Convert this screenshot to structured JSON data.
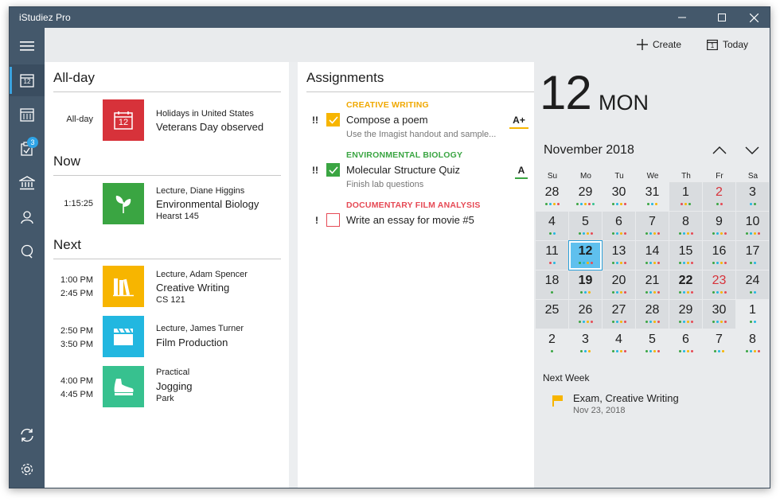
{
  "app": {
    "title": "iStudiez Pro"
  },
  "toolbar": {
    "create_label": "Create",
    "today_label": "Today",
    "today_icon_number": "1"
  },
  "sidebar": {
    "calendar_number": "12",
    "assignments_badge": "3"
  },
  "schedule": {
    "allday_title": "All-day",
    "now_title": "Now",
    "next_title": "Next",
    "allday": {
      "time": "All-day",
      "icon_number": "12",
      "subtitle": "Holidays in United States",
      "title": "Veterans Day observed",
      "color": "#d7323a"
    },
    "now": {
      "time": "1:15:25",
      "subtitle": "Lecture, Diane Higgins",
      "title": "Environmental Biology",
      "location": "Hearst 145",
      "color": "#3aa542"
    },
    "next": [
      {
        "start": "1:00 PM",
        "end": "2:45 PM",
        "subtitle": "Lecture, Adam Spencer",
        "title": "Creative Writing",
        "location": "CS 121",
        "color": "#f7b500",
        "icon": "books-icon"
      },
      {
        "start": "2:50 PM",
        "end": "3:50 PM",
        "subtitle": "Lecture, James Turner",
        "title": "Film Production",
        "location": "",
        "color": "#22b7e0",
        "icon": "clapperboard-icon"
      },
      {
        "start": "4:00 PM",
        "end": "4:45 PM",
        "subtitle": "Practical",
        "title": "Jogging",
        "location": "Park",
        "color": "#37c18f",
        "icon": "sneaker-icon"
      }
    ]
  },
  "assignments": {
    "title": "Assignments",
    "items": [
      {
        "category": "CREATIVE WRITING",
        "category_color": "#f0a800",
        "priority": "!!",
        "title": "Compose a poem",
        "note": "Use the Imagist handout and sample...",
        "grade": "A+",
        "checked": true,
        "check_color": "#f7b500"
      },
      {
        "category": "ENVIRONMENTAL BIOLOGY",
        "category_color": "#3aa542",
        "priority": "!!",
        "title": "Molecular Structure Quiz",
        "note": "Finish lab questions",
        "grade": "A",
        "checked": true,
        "check_color": "#3aa542"
      },
      {
        "category": "DOCUMENTARY FILM ANALYSIS",
        "category_color": "#e64a55",
        "priority": "!",
        "title": "Write an essay for movie #5",
        "note": "",
        "grade": "",
        "checked": false,
        "check_color": "#e64a55"
      }
    ]
  },
  "calendar": {
    "big_date": "12",
    "big_day": "MON",
    "month_label": "November 2018",
    "weekdays": [
      "Su",
      "Mo",
      "Tu",
      "We",
      "Th",
      "Fr",
      "Sa"
    ],
    "weeks": [
      [
        {
          "d": "28",
          "c": [
            "#3aa542",
            "#22b7e0",
            "#f7b500",
            "#e64a55"
          ]
        },
        {
          "d": "29",
          "c": [
            "#3aa542",
            "#22b7e0",
            "#f7b500",
            "#e64a55",
            "#37c18f"
          ]
        },
        {
          "d": "30",
          "c": [
            "#3aa542",
            "#22b7e0",
            "#f7b500",
            "#e64a55"
          ]
        },
        {
          "d": "31",
          "c": [
            "#3aa542",
            "#22b7e0",
            "#f7b500"
          ]
        },
        {
          "d": "1",
          "c": [
            "#e64a55",
            "#f7b500",
            "#3aa542"
          ],
          "cur": true
        },
        {
          "d": "2",
          "c": [
            "#3aa542",
            "#e64a55"
          ],
          "cur": true,
          "red": true
        },
        {
          "d": "3",
          "c": [
            "#22b7e0",
            "#3aa542"
          ],
          "cur": true
        }
      ],
      [
        {
          "d": "4",
          "c": [
            "#3aa542",
            "#22b7e0"
          ],
          "cur": true
        },
        {
          "d": "5",
          "c": [
            "#3aa542",
            "#22b7e0",
            "#f7b500",
            "#e64a55"
          ],
          "cur": true
        },
        {
          "d": "6",
          "c": [
            "#3aa542",
            "#22b7e0",
            "#f7b500",
            "#e64a55"
          ],
          "cur": true
        },
        {
          "d": "7",
          "c": [
            "#3aa542",
            "#22b7e0",
            "#f7b500",
            "#e64a55"
          ],
          "cur": true
        },
        {
          "d": "8",
          "c": [
            "#3aa542",
            "#22b7e0",
            "#f7b500",
            "#e64a55"
          ],
          "cur": true
        },
        {
          "d": "9",
          "c": [
            "#3aa542",
            "#22b7e0",
            "#f7b500",
            "#e64a55"
          ],
          "cur": true
        },
        {
          "d": "10",
          "c": [
            "#3aa542",
            "#22b7e0",
            "#f7b500",
            "#e64a55"
          ],
          "cur": true
        }
      ],
      [
        {
          "d": "11",
          "c": [
            "#e64a55",
            "#22b7e0"
          ],
          "cur": true
        },
        {
          "d": "12",
          "c": [
            "#3aa542",
            "#22b7e0",
            "#f7b500",
            "#e64a55"
          ],
          "cur": true,
          "sel": true,
          "bold": true
        },
        {
          "d": "13",
          "c": [
            "#3aa542",
            "#22b7e0",
            "#f7b500",
            "#e64a55"
          ],
          "cur": true
        },
        {
          "d": "14",
          "c": [
            "#3aa542",
            "#22b7e0",
            "#f7b500",
            "#e64a55"
          ],
          "cur": true
        },
        {
          "d": "15",
          "c": [
            "#3aa542",
            "#22b7e0",
            "#f7b500",
            "#e64a55"
          ],
          "cur": true
        },
        {
          "d": "16",
          "c": [
            "#3aa542",
            "#22b7e0",
            "#f7b500",
            "#e64a55"
          ],
          "cur": true
        },
        {
          "d": "17",
          "c": [
            "#3aa542",
            "#22b7e0"
          ],
          "cur": true
        }
      ],
      [
        {
          "d": "18",
          "c": [
            "#3aa542"
          ],
          "cur": true
        },
        {
          "d": "19",
          "c": [
            "#3aa542",
            "#22b7e0",
            "#f7b500"
          ],
          "cur": true,
          "bold": true
        },
        {
          "d": "20",
          "c": [
            "#3aa542",
            "#22b7e0",
            "#f7b500",
            "#e64a55"
          ],
          "cur": true
        },
        {
          "d": "21",
          "c": [
            "#3aa542",
            "#22b7e0",
            "#f7b500",
            "#e64a55"
          ],
          "cur": true
        },
        {
          "d": "22",
          "c": [
            "#3aa542",
            "#22b7e0",
            "#f7b500",
            "#e64a55"
          ],
          "cur": true,
          "bold": true
        },
        {
          "d": "23",
          "c": [
            "#3aa542",
            "#22b7e0",
            "#f7b500",
            "#e64a55"
          ],
          "cur": true,
          "red": true
        },
        {
          "d": "24",
          "c": [
            "#3aa542",
            "#22b7e0"
          ],
          "cur": true
        }
      ],
      [
        {
          "d": "25",
          "c": [],
          "cur": true
        },
        {
          "d": "26",
          "c": [
            "#3aa542",
            "#22b7e0",
            "#f7b500",
            "#e64a55"
          ],
          "cur": true
        },
        {
          "d": "27",
          "c": [
            "#3aa542",
            "#22b7e0",
            "#f7b500",
            "#e64a55"
          ],
          "cur": true
        },
        {
          "d": "28",
          "c": [
            "#3aa542",
            "#22b7e0",
            "#f7b500",
            "#e64a55"
          ],
          "cur": true
        },
        {
          "d": "29",
          "c": [
            "#3aa542",
            "#22b7e0",
            "#f7b500",
            "#e64a55"
          ],
          "cur": true
        },
        {
          "d": "30",
          "c": [
            "#3aa542",
            "#22b7e0",
            "#f7b500",
            "#e64a55"
          ],
          "cur": true
        },
        {
          "d": "1",
          "c": [
            "#3aa542",
            "#22b7e0"
          ]
        }
      ],
      [
        {
          "d": "2",
          "c": [
            "#3aa542"
          ]
        },
        {
          "d": "3",
          "c": [
            "#3aa542",
            "#22b7e0",
            "#f7b500"
          ]
        },
        {
          "d": "4",
          "c": [
            "#3aa542",
            "#22b7e0",
            "#f7b500",
            "#e64a55"
          ]
        },
        {
          "d": "5",
          "c": [
            "#3aa542",
            "#22b7e0",
            "#f7b500",
            "#e64a55"
          ]
        },
        {
          "d": "6",
          "c": [
            "#3aa542",
            "#22b7e0",
            "#f7b500",
            "#e64a55"
          ]
        },
        {
          "d": "7",
          "c": [
            "#3aa542",
            "#22b7e0",
            "#f7b500"
          ]
        },
        {
          "d": "8",
          "c": [
            "#3aa542",
            "#22b7e0",
            "#f7b500",
            "#e64a55"
          ]
        }
      ]
    ]
  },
  "next_week": {
    "label": "Next Week",
    "event_title": "Exam, Creative Writing",
    "event_date": "Nov 23, 2018",
    "flag_color": "#f7b500"
  }
}
